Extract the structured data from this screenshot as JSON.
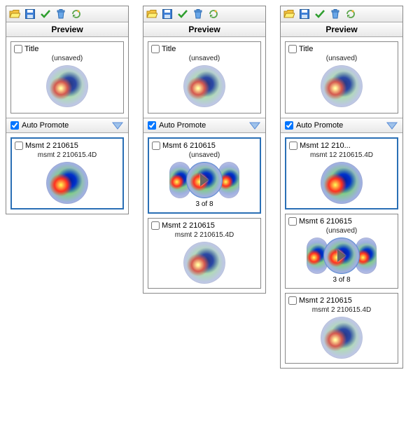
{
  "panels": [
    {
      "header": "Preview",
      "title_checkbox": {
        "label": "Title",
        "checked": false
      },
      "title_sub": "(unsaved)",
      "auto_promote": {
        "label": "Auto Promote",
        "checked": true
      },
      "items": [
        {
          "label": "Msmt 2 210615",
          "checked": false,
          "sub": "msmt 2 210615.4D",
          "selected": true,
          "mode": "single",
          "faded": false
        }
      ]
    },
    {
      "header": "Preview",
      "title_checkbox": {
        "label": "Title",
        "checked": false
      },
      "title_sub": "(unsaved)",
      "auto_promote": {
        "label": "Auto Promote",
        "checked": true
      },
      "items": [
        {
          "label": "Msmt 6 210615",
          "checked": false,
          "sub": "(unsaved)",
          "selected": true,
          "mode": "triple",
          "count": "3 of 8"
        },
        {
          "label": "Msmt 2 210615",
          "checked": false,
          "sub": "msmt 2 210615.4D",
          "selected": false,
          "mode": "single",
          "faded": true
        }
      ]
    },
    {
      "header": "Preview",
      "title_checkbox": {
        "label": "Title",
        "checked": false
      },
      "title_sub": "(unsaved)",
      "auto_promote": {
        "label": "Auto Promote",
        "checked": true
      },
      "items": [
        {
          "label": "Msmt 12 210...",
          "checked": false,
          "sub": "msmt 12 210615.4D",
          "selected": true,
          "mode": "single",
          "faded": false
        },
        {
          "label": "Msmt 6 210615",
          "checked": false,
          "sub": "(unsaved)",
          "selected": false,
          "mode": "triple",
          "count": "3 of 8"
        },
        {
          "label": "Msmt 2 210615",
          "checked": false,
          "sub": "msmt 2 210615.4D",
          "selected": false,
          "mode": "single",
          "faded": true
        }
      ]
    }
  ]
}
